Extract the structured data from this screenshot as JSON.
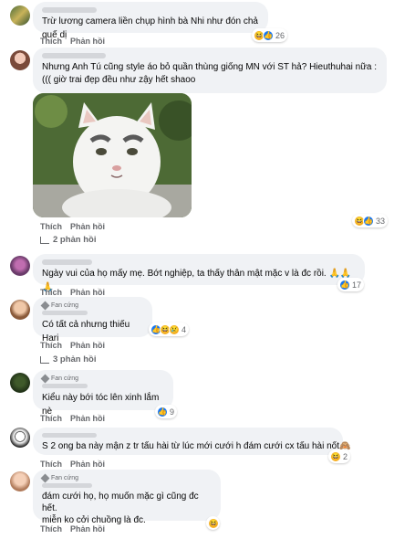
{
  "actions": {
    "like": "Thích",
    "reply": "Phản hồi"
  },
  "comments": [
    {
      "text": "Trừ lương camera liền chụp hình bà Nhi như đón chả quế dị",
      "reaction_count": "26"
    },
    {
      "text_line1": "Nhưng Anh Tú cũng style áo bỏ quần thùng giống MN với ST hả? Hieuthuhai nữa :",
      "text_line2": "((( giờ trai đẹp đều như zậy hết shaoo",
      "reaction_count": "33",
      "replies": "2 phản hồi"
    },
    {
      "text": "Ngày vui của họ mấy mẹ. Bớt nghiệp, ta thấy thân mật mặc v là đc rồi. 🙏🙏🙏",
      "reaction_count": "17"
    },
    {
      "badge": "Fan cứng",
      "text": "Có tất cả nhưng thiếu Hari",
      "reaction_count": "4",
      "replies": "3 phản hồi"
    },
    {
      "badge": "Fan cứng",
      "text": "Kiểu này bới tóc lên xinh lắm nè",
      "reaction_count": "9"
    },
    {
      "text": "S 2 ong ba này mận z tr tấu hài từ lúc mới cưới h đám cưới cx tấu hài nốt🙈",
      "reaction_count": "2"
    },
    {
      "badge": "Fan cứng",
      "text_line1": "đám cưới họ, họ muốn mặc gì cũng đc hết.",
      "text_line2": "miễn ko cởi chuồng là đc."
    }
  ],
  "colors": {
    "bubble": "#f0f2f5",
    "meta": "#65676b",
    "like": "#1877f2",
    "haha": "#f7b125"
  }
}
